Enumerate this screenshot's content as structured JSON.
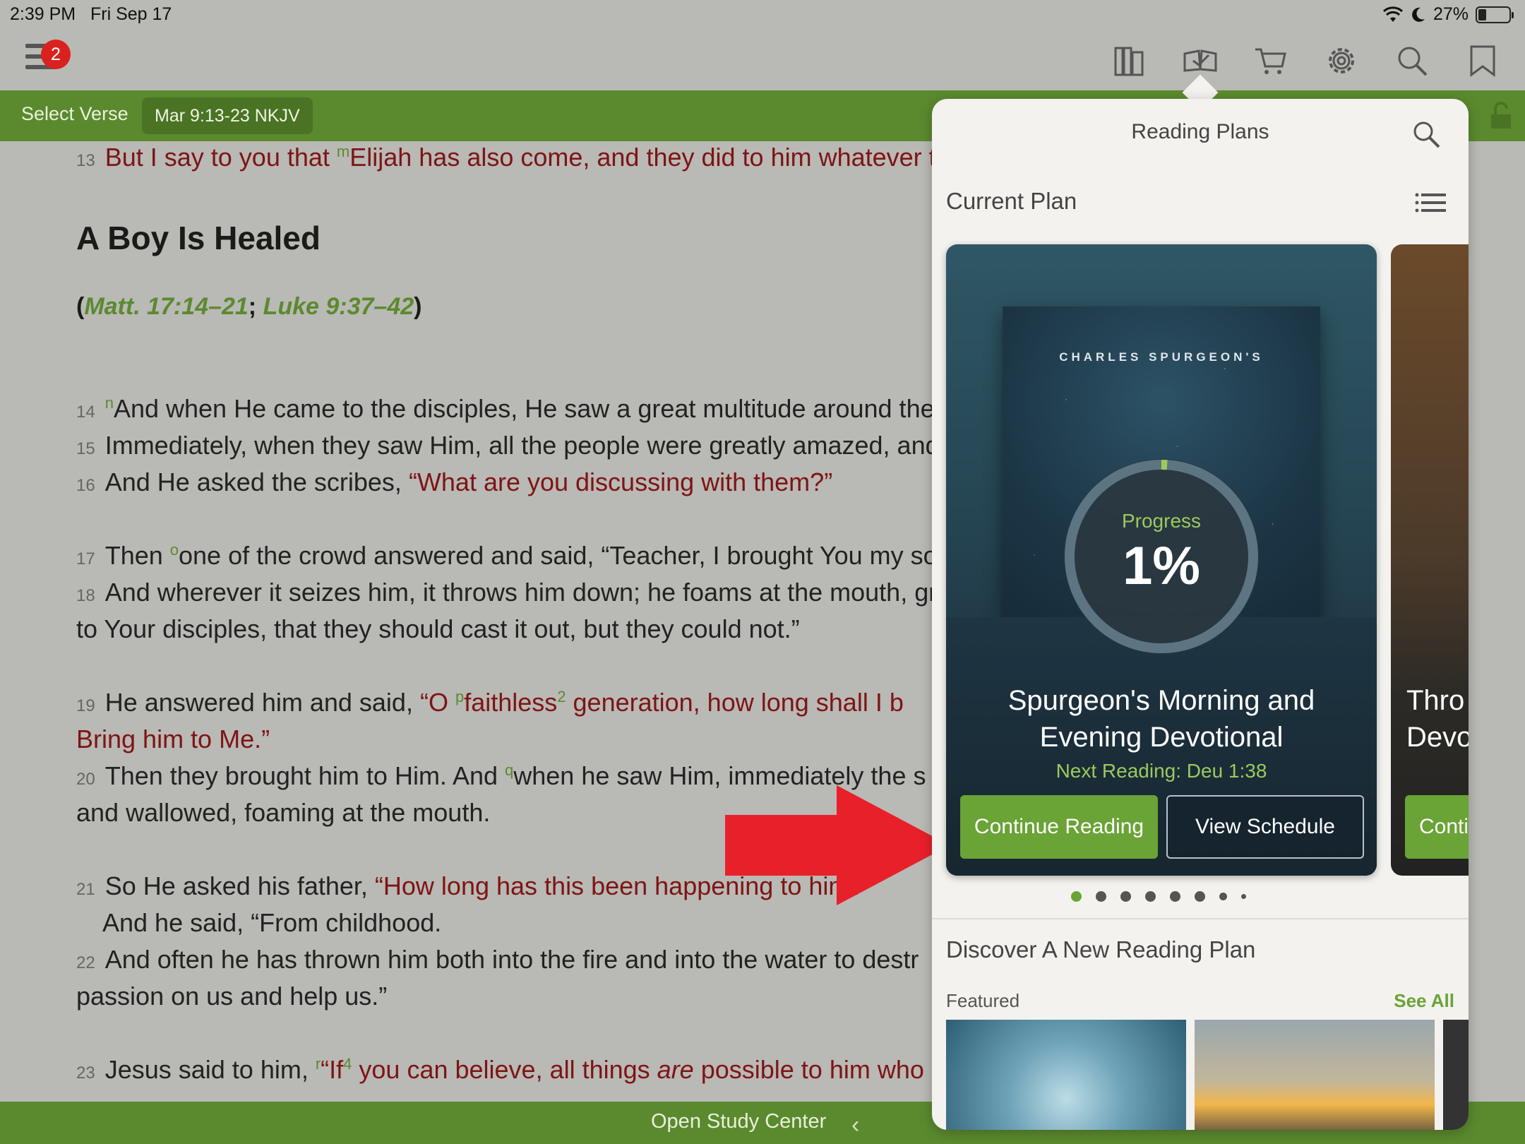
{
  "status": {
    "time": "2:39 PM",
    "date": "Fri Sep 17",
    "battery": "27%"
  },
  "toolbar": {
    "badge_count": "2",
    "icons": [
      "library-icon",
      "reading-plans-icon",
      "cart-icon",
      "settings-icon",
      "search-icon",
      "bookmark-icon"
    ]
  },
  "versebar": {
    "select_label": "Select Verse",
    "reference": "Mar 9:13-23 NKJV"
  },
  "bible": {
    "v13": {
      "num": "13",
      "a": "But I say to you that ",
      "m": "m",
      "b": "Elijah has also come, and they did to him whatever t"
    },
    "heading": "A Boy Is Healed",
    "xref": {
      "open": "(",
      "r1": "Matt. 17:14–21",
      "sep": "; ",
      "r2": "Luke 9:37–42",
      "close": ")"
    },
    "v14": {
      "num": "14",
      "n": "n",
      "text": "And when He came to the disciples, He saw a great multitude around ther"
    },
    "v15": {
      "num": "15",
      "text": "Immediately, when they saw Him, all the people were greatly amazed, and"
    },
    "v16": {
      "num": "16",
      "a": "And He asked the scribes, ",
      "b": "“What are you discussing with them?”"
    },
    "v17": {
      "num": "17",
      "a": "Then ",
      "o": "o",
      "b": "one of the crowd answered and said, “Teacher, I brought You my sor"
    },
    "v18": {
      "num": "18",
      "text": "And wherever it seizes him, it throws him down; he foams at the mouth, gr",
      "cont": "to Your disciples, that they should cast it out, but they could not.”"
    },
    "v19": {
      "num": "19",
      "a": "He answered him and said, ",
      "b": "“O ",
      "p": "p",
      "c": "faithless",
      "n2": "2",
      "d": " generation, how long shall I b",
      "cont": "Bring him to Me.”"
    },
    "v20": {
      "num": "20",
      "a": "Then they brought him to Him. And ",
      "q": "q",
      "b": "when he saw Him, immediately the s",
      "cont": "and wallowed, foaming at the mouth."
    },
    "v21": {
      "num": "21",
      "a": "So He asked his father, ",
      "b": "“How long has this been happening to him?”",
      "cont": "And he said, “From childhood."
    },
    "v22": {
      "num": "22",
      "text": "And often he has thrown him both into the fire and into the water to destr",
      "cont": "passion on us and help us.”"
    },
    "v23": {
      "num": "23",
      "a": "Jesus said to him, ",
      "r": "r",
      "b": "“If",
      "n4": "4",
      "c": " you can believe, all things ",
      "i": "are",
      "d": " possible to him who b"
    }
  },
  "bottombar": {
    "label": "Open Study Center"
  },
  "popover": {
    "title": "Reading Plans",
    "current_plan": "Current Plan",
    "card": {
      "cover_text": "CHARLES SPURGEON'S",
      "progress_label": "Progress",
      "progress_value": "1%",
      "progress_fraction": 0.01,
      "title_line1": "Spurgeon's Morning and",
      "title_line2": "Evening Devotional",
      "next_reading": "Next Reading: Deu 1:38",
      "continue_label": "Continue Reading",
      "schedule_label": "View Schedule"
    },
    "card2": {
      "title_line1": "Thro",
      "title_line2": "Devo",
      "continue_label": "Conti"
    },
    "discover": "Discover A New Reading Plan",
    "featured": "Featured",
    "see_all": "See All"
  },
  "colors": {
    "brand_green": "#5b8a2e",
    "button_green": "#6aa336",
    "red_letter": "#7e1414",
    "arrow_red": "#e8202a"
  }
}
